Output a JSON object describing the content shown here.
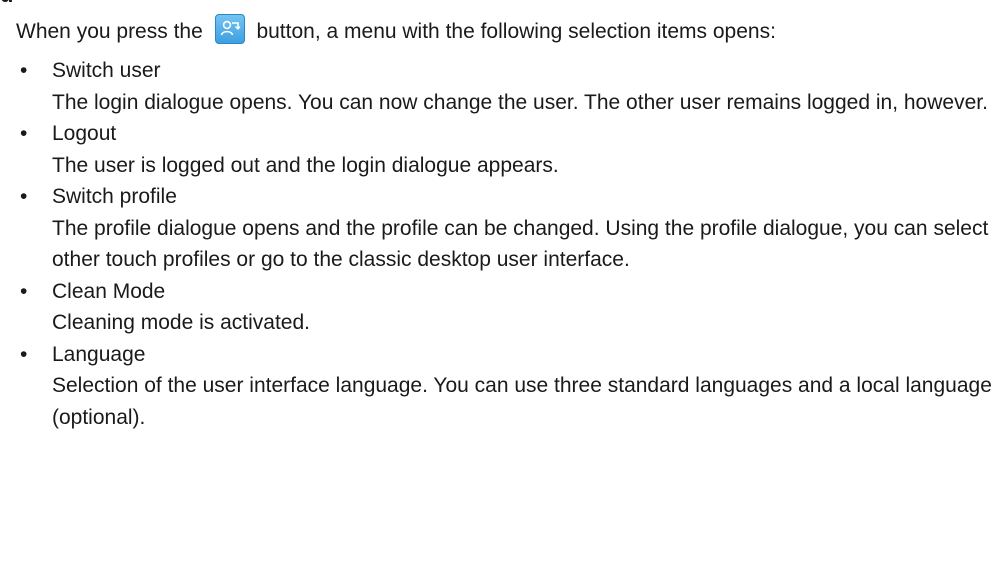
{
  "heading_fragment": "u",
  "intro": {
    "before": "When you press the",
    "after": "button, a menu with the following selection items opens:",
    "icon": "user-switch-icon"
  },
  "items": [
    {
      "title": "Switch user",
      "description": "The login dialogue opens. You can now change the user. The other user remains logged in, however."
    },
    {
      "title": "Logout",
      "description": "The user is logged out and the login dialogue appears."
    },
    {
      "title": "Switch profile",
      "description": "The profile dialogue opens and the profile can be changed. Using the profile dialogue, you can select other touch profiles or go to the classic desktop user interface."
    },
    {
      "title": "Clean Mode",
      "description": "Cleaning mode is activated."
    },
    {
      "title": "Language",
      "description": "Selection of the user interface language. You can use three standard languages and a local language (optional)."
    }
  ],
  "colors": {
    "icon_fill": "#4eaeea",
    "icon_border": "#2f86c6",
    "text": "#1a1a1a"
  }
}
